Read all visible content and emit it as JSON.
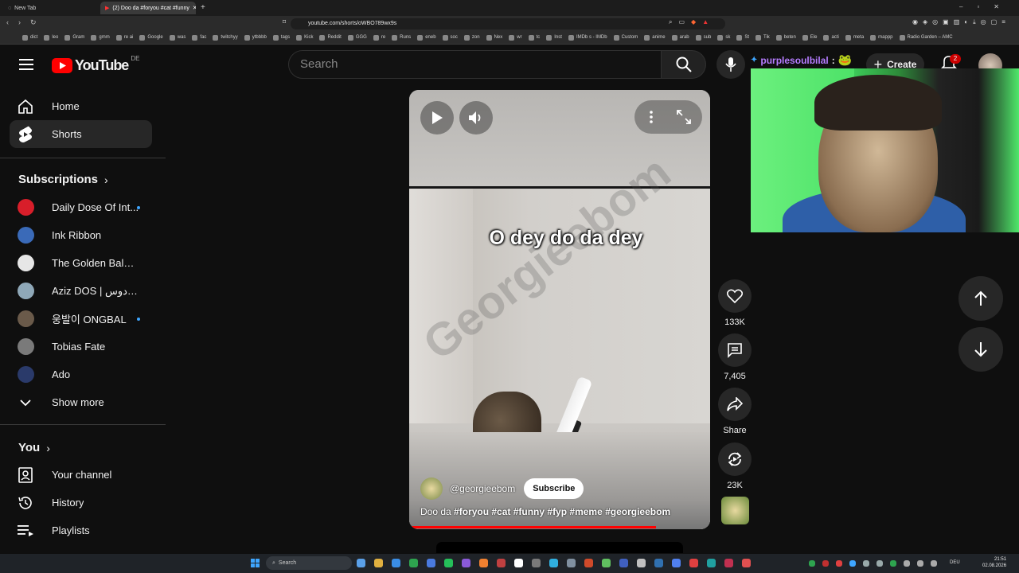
{
  "browser": {
    "tabs": [
      {
        "title": "New Tab"
      },
      {
        "title": "(2) Doo da #foryou #cat #funny"
      }
    ],
    "url": "youtube.com/shorts/oWBO789wx9s",
    "bookmarks": [
      "dict",
      "leo",
      "Gram",
      "gmm",
      "re ai",
      "Google",
      "was",
      "fac",
      "twitchyy",
      "ytbbbb",
      "tags",
      "Kick",
      "Reddit",
      "GGG",
      "re",
      "Runs",
      "eneb",
      "soc",
      "zon",
      "Nex",
      "wr",
      "tc",
      "Inst",
      "IMDb s - IMDb",
      "Custom",
      "anime",
      "arab",
      "sub",
      "sk",
      "St",
      "Tik",
      "beten",
      "Ele",
      "acti",
      "meta",
      "mappp",
      "Radio Garden – AMC"
    ]
  },
  "masthead": {
    "logo_text": "YouTube",
    "country": "DE",
    "search_placeholder": "Search",
    "create_label": "Create",
    "notification_count": "2"
  },
  "sidebar": {
    "main": [
      {
        "label": "Home",
        "icon": "home-icon"
      },
      {
        "label": "Shorts",
        "icon": "shorts-icon",
        "selected": true
      }
    ],
    "subscriptions_title": "Subscriptions",
    "subscriptions": [
      {
        "label": "Daily Dose Of Int...",
        "new": true,
        "color": "#d81e2a"
      },
      {
        "label": "Ink Ribbon",
        "new": false,
        "color": "#3a6ab8"
      },
      {
        "label": "The Golden Balance",
        "new": false,
        "color": "#e6e6e6"
      },
      {
        "label": "Aziz DOS | عزيز دوس",
        "new": false,
        "color": "#8fa8b8"
      },
      {
        "label": "웅발이 ONGBAL",
        "new": true,
        "color": "#6a5a4a"
      },
      {
        "label": "Tobias Fate",
        "new": false,
        "color": "#7a7a7a"
      },
      {
        "label": "Ado",
        "new": false,
        "color": "#2a3a6a"
      }
    ],
    "show_more": "Show more",
    "you_title": "You",
    "you_items": [
      {
        "label": "Your channel",
        "icon": "channel-icon"
      },
      {
        "label": "History",
        "icon": "history-icon"
      },
      {
        "label": "Playlists",
        "icon": "playlists-icon"
      }
    ]
  },
  "short": {
    "caption": "O dey do da dey",
    "watermark": "Georgieebom",
    "channel": "@georgieebom",
    "subscribe_label": "Subscribe",
    "description_prefix": "Doo da ",
    "hashtags": "#foryou #cat #funny #fyp #meme #georgieebom",
    "progress_percent": 82
  },
  "actions": {
    "likes": "133K",
    "comments": "7,405",
    "share": "Share",
    "remix": "23K"
  },
  "overlay": {
    "chat_user": "purplesoulbilal",
    "chat_sep": ":"
  },
  "taskbar": {
    "search": "Search",
    "lang": "DEU",
    "time": "21:51",
    "date": "02.08.2026"
  },
  "colors": {
    "accent": "#ff0000",
    "link": "#3ea6ff",
    "chat_name": "#b57cff"
  }
}
